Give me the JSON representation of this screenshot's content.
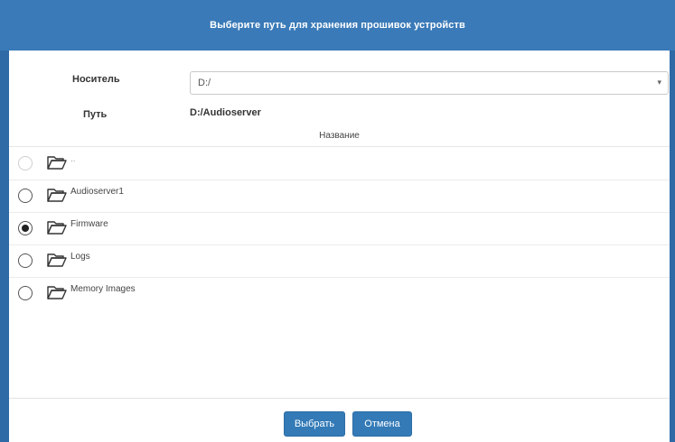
{
  "dialog": {
    "title": "Выберите путь для хранения прошивок устройств"
  },
  "form": {
    "media_label": "Носитель",
    "media_value": "D:/",
    "path_label": "Путь",
    "path_value": "D:/Audioserver"
  },
  "list": {
    "column_header": "Название",
    "items": [
      {
        "label": "..",
        "selected": false,
        "icon": "folder-icon"
      },
      {
        "label": "Audioserver1",
        "selected": false,
        "icon": "folder-icon"
      },
      {
        "label": "Firmware",
        "selected": true,
        "icon": "folder-icon"
      },
      {
        "label": "Logs",
        "selected": false,
        "icon": "folder-icon"
      },
      {
        "label": "Memory Images",
        "selected": false,
        "icon": "folder-icon"
      }
    ]
  },
  "footer": {
    "select_label": "Выбрать",
    "cancel_label": "Отмена"
  },
  "colors": {
    "header": "#3a7ab8",
    "accent": "#337ab7"
  }
}
